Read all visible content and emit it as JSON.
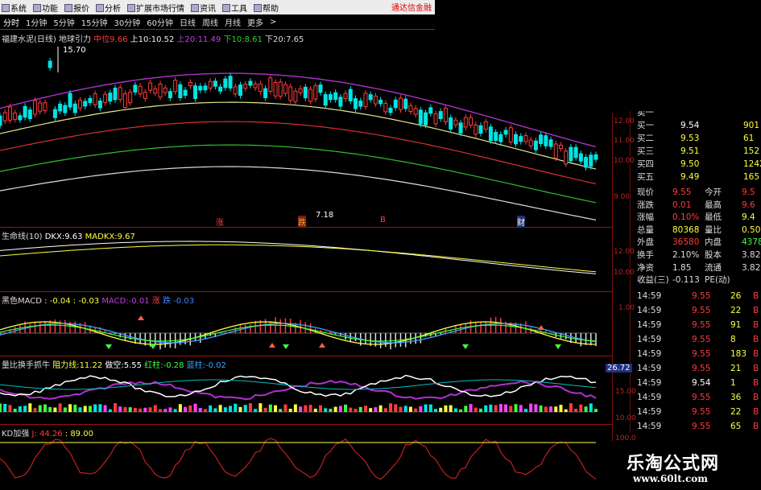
{
  "menu": [
    "系统",
    "功能",
    "报价",
    "分析",
    "扩展市场行情",
    "资讯",
    "工具",
    "帮助"
  ],
  "brand_red": "通达信金融",
  "periods": [
    "分时",
    "1分钟",
    "5分钟",
    "15分钟",
    "30分钟",
    "60分钟",
    "日线",
    "周线",
    "月线",
    "更多",
    ">"
  ],
  "main_panel": {
    "indicator": "福建水泥(日线) 地球引力",
    "mid_label": "中位",
    "mid_value": "9.66",
    "up10_label": "上10:",
    "up10_value": "10.52",
    "up20_label": "上20:",
    "up20_value": "11.49",
    "down10_label": "下10:",
    "down10_value": "8.61",
    "down20_label": "下20:",
    "down20_value": "7.65",
    "high_mark": "15.70",
    "low_mark": "7.18",
    "axis": [
      "12.00",
      "11.00",
      "10.00",
      "9.00"
    ],
    "markers": [
      "涨",
      "跌",
      "B",
      "财"
    ]
  },
  "dkx_panel": {
    "title": "生命线(10)",
    "dkx_label": "DKX:",
    "dkx_value": "9.63",
    "madkx_label": "MADKX:",
    "madkx_value": "9.67",
    "axis": [
      "12.00",
      "10.00"
    ]
  },
  "macd_panel": {
    "title": "黑色MACD",
    "v1": ": -0.04",
    "v2": ": -0.03",
    "macd_label": "MACD:",
    "macd_value": "-0.01",
    "rise_label": "涨",
    "fall_label": "跌",
    "fall_value": "-0.03",
    "axis": [
      "1.00"
    ]
  },
  "fund_panel": {
    "title": "量比换手抓牛",
    "resist_label": "阻力线:",
    "resist_value": "11.22",
    "short_label": "做空:",
    "short_value": "5.55",
    "red_label": "红柱:",
    "red_value": "-0.28",
    "blue_label": "蓝柱:",
    "blue_value": "-0.02",
    "box_value": "26.72",
    "axis": [
      "15.00",
      "10.00"
    ]
  },
  "kd_panel": {
    "title": "KD加强",
    "j_value": "J: 44.26",
    "v2": ": 89.00",
    "axis": [
      "100.0"
    ]
  },
  "quote_panel": {
    "bids": [
      {
        "label": "卖一",
        "price": "",
        "vol": ""
      },
      {
        "label": "买一",
        "price": "9.54",
        "vol": "901"
      },
      {
        "label": "买二",
        "price": "9.53",
        "vol": "61"
      },
      {
        "label": "买三",
        "price": "9.51",
        "vol": "152"
      },
      {
        "label": "买四",
        "price": "9.50",
        "vol": "1242"
      },
      {
        "label": "买五",
        "price": "9.49",
        "vol": "165"
      }
    ],
    "stats": [
      {
        "l1": "现价",
        "v1": "9.55",
        "l2": "今开",
        "v2": "9.5"
      },
      {
        "l1": "涨跌",
        "v1": "0.01",
        "l2": "最高",
        "v2": "9.6"
      },
      {
        "l1": "涨幅",
        "v1": "0.10%",
        "l2": "最低",
        "v2": "9.4"
      },
      {
        "l1": "总量",
        "v1": "80368",
        "l2": "量比",
        "v2": "0.50"
      },
      {
        "l1": "外盘",
        "v1": "36580",
        "l2": "内盘",
        "v2": "43788"
      },
      {
        "l1": "换手",
        "v1": "2.10%",
        "l2": "股本",
        "v2": "3.82亿"
      },
      {
        "l1": "净资",
        "v1": "1.85",
        "l2": "流通",
        "v2": "3.82亿"
      },
      {
        "l1": "收益(三)",
        "v1": "-0.113",
        "l2": "PE(动)",
        "v2": ""
      }
    ],
    "ticks": [
      {
        "time": "14:59",
        "price": "9.55",
        "vol": "26",
        "bs": "B"
      },
      {
        "time": "14:59",
        "price": "9.55",
        "vol": "22",
        "bs": "B"
      },
      {
        "time": "14:59",
        "price": "9.55",
        "vol": "91",
        "bs": "B"
      },
      {
        "time": "14:59",
        "price": "9.55",
        "vol": "8",
        "bs": "B"
      },
      {
        "time": "14:59",
        "price": "9.55",
        "vol": "183",
        "bs": "B"
      },
      {
        "time": "14:59",
        "price": "9.55",
        "vol": "21",
        "bs": "B"
      },
      {
        "time": "14:59",
        "price": "9.54",
        "vol": "1",
        "bs": "B"
      },
      {
        "time": "14:59",
        "price": "9.55",
        "vol": "36",
        "bs": "B"
      },
      {
        "time": "14:59",
        "price": "9.55",
        "vol": "22",
        "bs": "B"
      },
      {
        "time": "14:59",
        "price": "9.55",
        "vol": "65",
        "bs": "B"
      }
    ]
  },
  "logo": {
    "name": "乐淘公式网",
    "url": "www.60lt.com"
  },
  "colors": {
    "up": "#ff3c3c",
    "down": "#00e5e5",
    "accent_yellow": "#ffff00",
    "purple": "#b030d0",
    "grid": "#9b1010"
  }
}
